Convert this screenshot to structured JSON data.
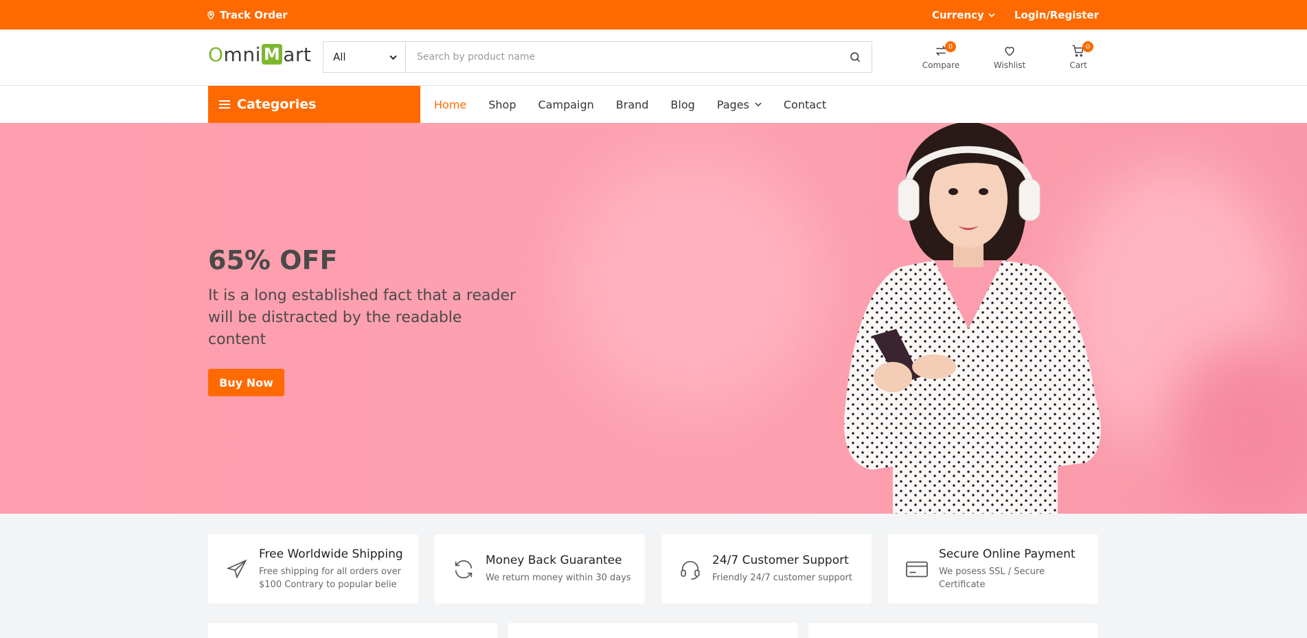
{
  "topbar": {
    "track_order": "Track Order",
    "currency": "Currency",
    "login": "Login/Register"
  },
  "header": {
    "logo": {
      "o": "O",
      "mni": "mni",
      "m": "M",
      "art": "art"
    },
    "search": {
      "category": "All",
      "placeholder": "Search by product name"
    },
    "compare": {
      "label": "Compare",
      "count": "0"
    },
    "wishlist": {
      "label": "Wishlist"
    },
    "cart": {
      "label": "Cart",
      "count": "0"
    }
  },
  "nav": {
    "categories": "Categories",
    "items": [
      "Home",
      "Shop",
      "Campaign",
      "Brand",
      "Blog",
      "Pages",
      "Contact"
    ]
  },
  "hero": {
    "title": "65% OFF",
    "description": "It is a long established fact that a reader will be distracted by the readable content",
    "button": "Buy Now"
  },
  "features": [
    {
      "title": "Free Worldwide Shipping",
      "desc": "Free shipping for all orders over $100 Contrary to popular belie",
      "icon": "plane-icon"
    },
    {
      "title": "Money Back Guarantee",
      "desc": "We return money within 30 days",
      "icon": "refresh-icon"
    },
    {
      "title": "24/7 Customer Support",
      "desc": "Friendly 24/7 customer support",
      "icon": "headset-icon"
    },
    {
      "title": "Secure Online Payment",
      "desc": "We posess SSL / Secure Certificate",
      "icon": "credit-card-icon"
    }
  ],
  "colors": {
    "accent": "#ff6a00",
    "logo_green": "#7cb82f",
    "hero_bg": "#fda1b0"
  }
}
